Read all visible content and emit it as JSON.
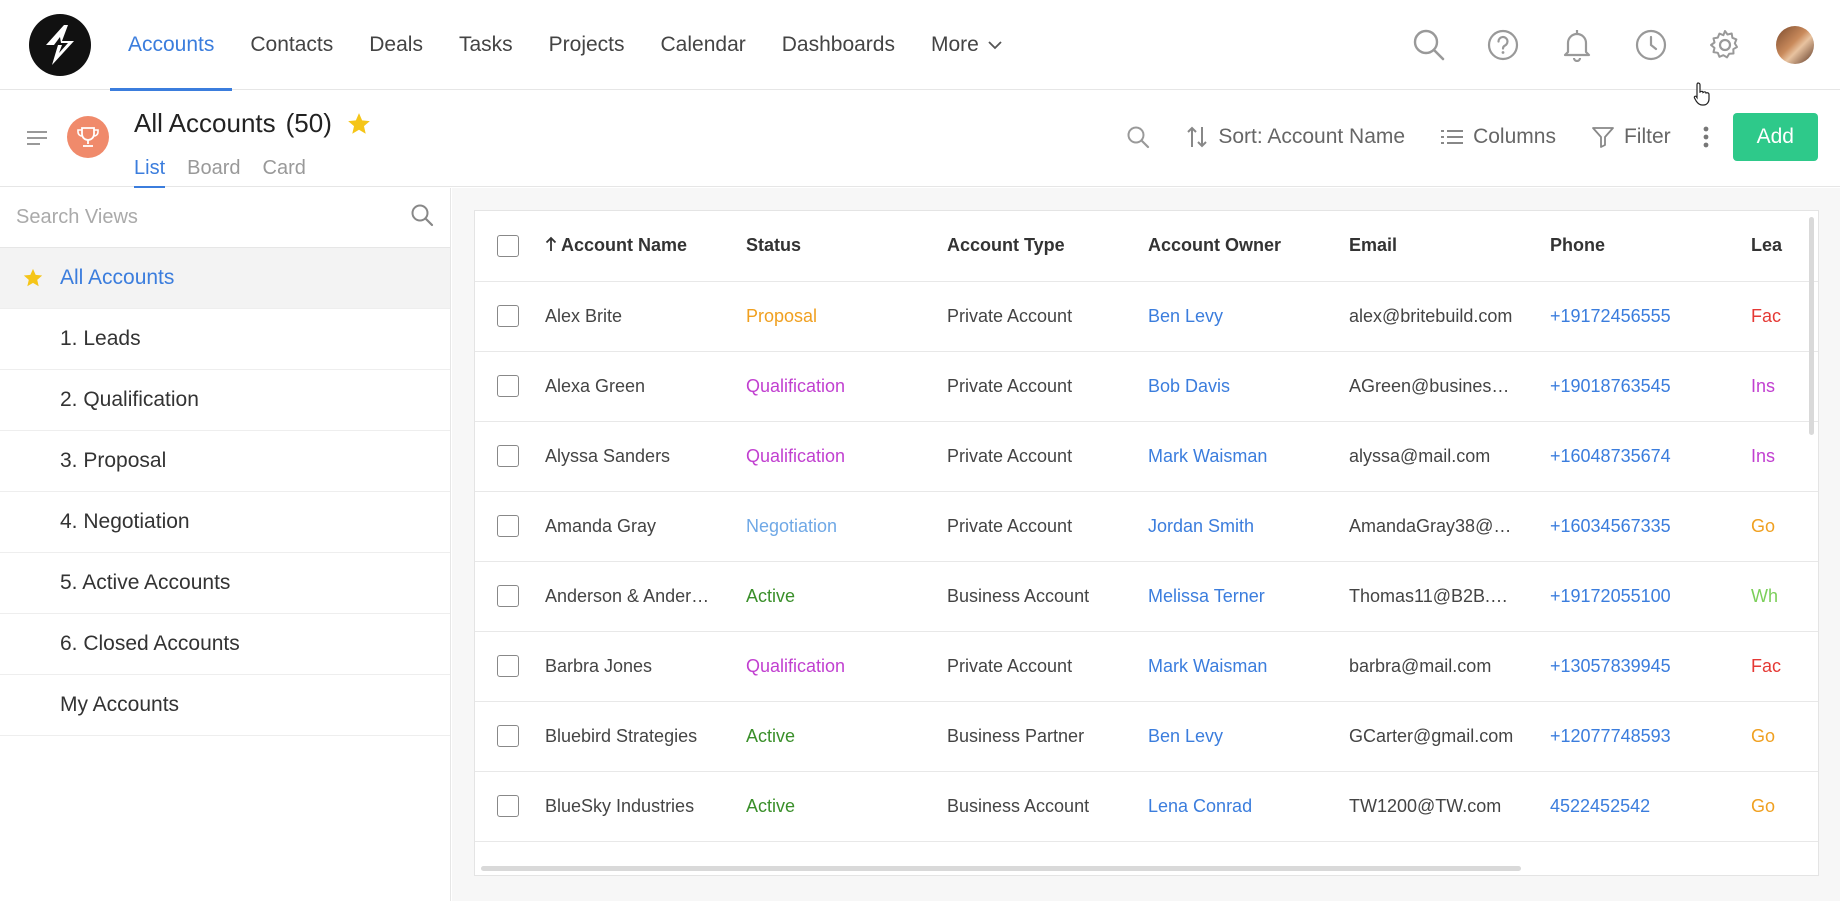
{
  "nav": {
    "items": [
      {
        "label": "Accounts",
        "active": true
      },
      {
        "label": "Contacts"
      },
      {
        "label": "Deals"
      },
      {
        "label": "Tasks"
      },
      {
        "label": "Projects"
      },
      {
        "label": "Calendar"
      },
      {
        "label": "Dashboards"
      },
      {
        "label": "More"
      }
    ],
    "icons": [
      "search-icon",
      "help-icon",
      "bell-icon",
      "clock-icon",
      "gear-icon",
      "avatar"
    ]
  },
  "header": {
    "title": "All Accounts",
    "count": "(50)",
    "tabs": [
      "List",
      "Board",
      "Card"
    ],
    "active_tab": "List",
    "sort_label": "Sort: Account Name",
    "columns_label": "Columns",
    "filter_label": "Filter",
    "add_label": "Add"
  },
  "sidebar": {
    "search_placeholder": "Search Views",
    "views": [
      {
        "label": "All Accounts",
        "active": true,
        "starred": true
      },
      {
        "label": "1. Leads"
      },
      {
        "label": "2. Qualification"
      },
      {
        "label": "3. Proposal"
      },
      {
        "label": "4. Negotiation"
      },
      {
        "label": "5. Active Accounts"
      },
      {
        "label": "6. Closed Accounts"
      },
      {
        "label": "My Accounts"
      }
    ]
  },
  "table": {
    "columns": [
      "Account Name",
      "Status",
      "Account Type",
      "Account Owner",
      "Email",
      "Phone",
      "Lea"
    ],
    "rows": [
      {
        "name": "Alex Brite",
        "status": "Proposal",
        "status_color": "#f0a020",
        "type": "Private Account",
        "owner": "Ben Levy",
        "email": "alex@britebuild.com",
        "phone": "+19172456555",
        "lead": "Fac",
        "lead_color": "#e53935"
      },
      {
        "name": "Alexa Green",
        "status": "Qualification",
        "status_color": "#c13fd0",
        "type": "Private Account",
        "owner": "Bob Davis",
        "email": "AGreen@busines…",
        "phone": "+19018763545",
        "lead": "Ins",
        "lead_color": "#c13fd0"
      },
      {
        "name": "Alyssa Sanders",
        "status": "Qualification",
        "status_color": "#c13fd0",
        "type": "Private Account",
        "owner": "Mark Waisman",
        "email": "alyssa@mail.com",
        "phone": "+16048735674",
        "lead": "Ins",
        "lead_color": "#c13fd0"
      },
      {
        "name": "Amanda Gray",
        "status": "Negotiation",
        "status_color": "#6fa8e6",
        "type": "Private Account",
        "owner": "Jordan Smith",
        "email": "AmandaGray38@…",
        "phone": "+16034567335",
        "lead": "Go",
        "lead_color": "#f0a020"
      },
      {
        "name": "Anderson & Ander…",
        "status": "Active",
        "status_color": "#3a8f2a",
        "type": "Business Account",
        "owner": "Melissa Terner",
        "email": "Thomas11@B2B.…",
        "phone": "+19172055100",
        "lead": "Wh",
        "lead_color": "#7ccf5a"
      },
      {
        "name": "Barbra Jones",
        "status": "Qualification",
        "status_color": "#c13fd0",
        "type": "Private Account",
        "owner": "Mark Waisman",
        "email": "barbra@mail.com",
        "phone": "+13057839945",
        "lead": "Fac",
        "lead_color": "#e53935"
      },
      {
        "name": "Bluebird Strategies",
        "status": "Active",
        "status_color": "#3a8f2a",
        "type": "Business Partner",
        "owner": "Ben Levy",
        "email": "GCarter@gmail.com",
        "phone": "+12077748593",
        "lead": "Go",
        "lead_color": "#f0a020"
      },
      {
        "name": "BlueSky Industries",
        "status": "Active",
        "status_color": "#3a8f2a",
        "type": "Business Account",
        "owner": "Lena Conrad",
        "email": "TW1200@TW.com",
        "phone": "4522452542",
        "lead": "Go",
        "lead_color": "#f0a020"
      }
    ]
  }
}
